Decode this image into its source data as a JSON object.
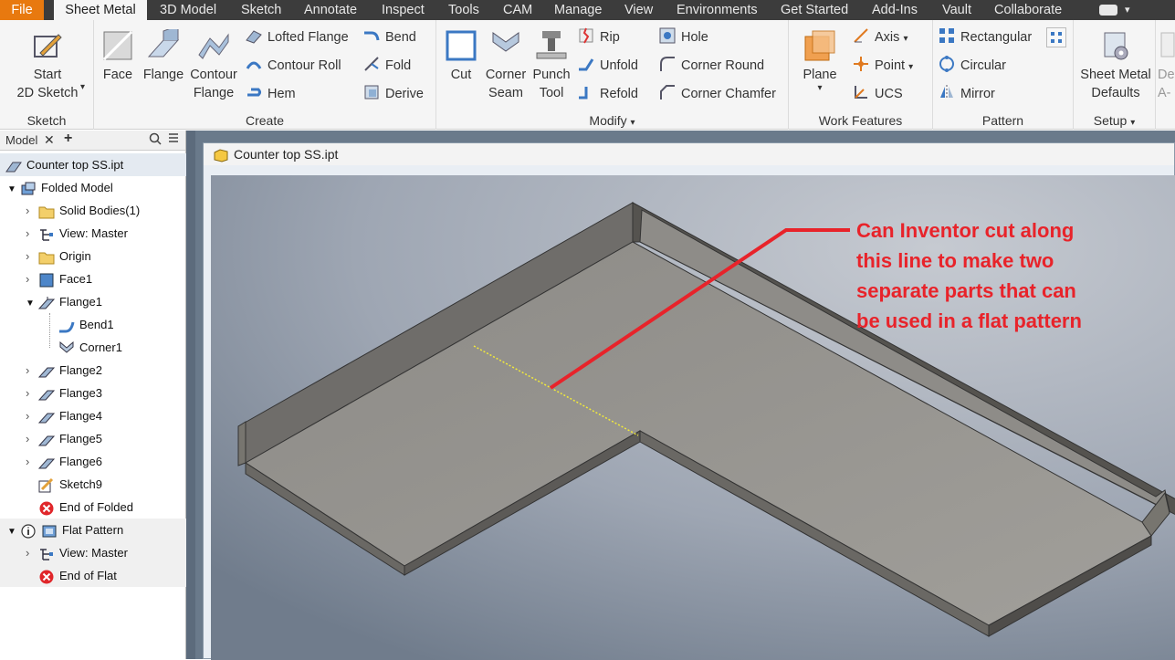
{
  "menu": {
    "file": "File",
    "tabs": [
      "Sheet Metal",
      "3D Model",
      "Sketch",
      "Annotate",
      "Inspect",
      "Tools",
      "CAM",
      "Manage",
      "View",
      "Environments",
      "Get Started",
      "Add-Ins",
      "Vault",
      "Collaborate"
    ]
  },
  "ribbon": {
    "sketch": {
      "title": "Sketch",
      "start_line1": "Start",
      "start_line2": "2D Sketch"
    },
    "create": {
      "title": "Create",
      "face": "Face",
      "flange": "Flange",
      "contour_flange_1": "Contour",
      "contour_flange_2": "Flange",
      "lofted_flange": "Lofted Flange",
      "contour_roll": "Contour Roll",
      "hem": "Hem",
      "bend": "Bend",
      "fold": "Fold",
      "derive": "Derive"
    },
    "modify": {
      "title": "Modify",
      "cut": "Cut",
      "corner_seam_1": "Corner",
      "corner_seam_2": "Seam",
      "punch_tool_1": "Punch",
      "punch_tool_2": "Tool",
      "rip": "Rip",
      "unfold": "Unfold",
      "refold": "Refold",
      "hole": "Hole",
      "corner_round": "Corner Round",
      "corner_chamfer": "Corner Chamfer"
    },
    "work_features": {
      "title": "Work Features",
      "plane": "Plane",
      "axis": "Axis",
      "point": "Point",
      "ucs": "UCS"
    },
    "pattern": {
      "title": "Pattern",
      "rectangular": "Rectangular",
      "circular": "Circular",
      "mirror": "Mirror"
    },
    "setup": {
      "title": "Setup",
      "defaults_1": "Sheet Metal",
      "defaults_2": "Defaults",
      "cut_1": "De",
      "cut_2": "A-"
    }
  },
  "browser": {
    "tab_label": "Model",
    "root": "Counter top SS.ipt",
    "items": [
      {
        "label": "Folded Model"
      },
      {
        "label": "Solid Bodies(1)"
      },
      {
        "label": "View: Master"
      },
      {
        "label": "Origin"
      },
      {
        "label": "Face1"
      },
      {
        "label": "Flange1"
      },
      {
        "label": "Bend1"
      },
      {
        "label": "Corner1"
      },
      {
        "label": "Flange2"
      },
      {
        "label": "Flange3"
      },
      {
        "label": "Flange4"
      },
      {
        "label": "Flange5"
      },
      {
        "label": "Flange6"
      },
      {
        "label": "Sketch9"
      },
      {
        "label": "End of Folded"
      },
      {
        "label": "Flat Pattern"
      },
      {
        "label": "View: Master"
      },
      {
        "label": "End of Flat"
      }
    ]
  },
  "document": {
    "title": "Counter top SS.ipt",
    "annotation": [
      "Can Inventor cut along",
      "this line to make two",
      "separate parts that can",
      "be used in a flat pattern"
    ],
    "annotation_color": "#e8232a"
  },
  "colors": {
    "file_tab": "#e8790f",
    "menubar": "#3c3c3c",
    "ribbon": "#f5f5f5",
    "accent_blue": "#3b78c3"
  }
}
